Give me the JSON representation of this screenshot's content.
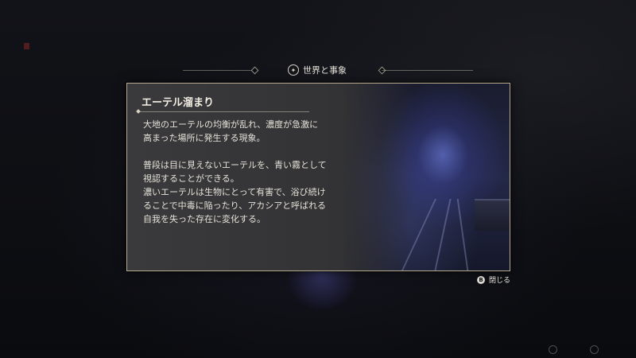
{
  "header": {
    "title": "世界と事象"
  },
  "entry": {
    "title": "エーテル溜まり",
    "paragraphs": [
      "大地のエーテルの均衡が乱れ、濃度が急激に\n高まった場所に発生する現象。",
      "普段は目に見えないエーテルを、青い霧として\n視認することができる。\n濃いエーテルは生物にとって有害で、浴び続け\nることで中毒に陥ったり、アカシアと呼ばれる\n自我を失った存在に変化する。"
    ]
  },
  "close": {
    "label": "閉じる",
    "key": "B"
  },
  "icons": {
    "header_emblem": "compass-emblem-icon",
    "close_key": "button-b-icon"
  },
  "colors": {
    "panel_border": "#b8ad92",
    "accent_blue": "#7888ff"
  }
}
